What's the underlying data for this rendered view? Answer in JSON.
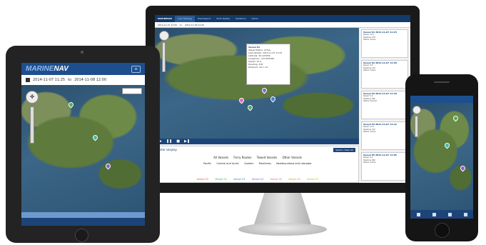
{
  "brand": {
    "logo_marine": "MARINE",
    "logo_nav": "NAV"
  },
  "monitor": {
    "nav_tabs": [
      "MARINENAV",
      "Live Tracking",
      "Fleet Report",
      "Track Replay",
      "Geofence",
      "Admin"
    ],
    "date_from": "2014-11-07 12:00",
    "to_label": "to",
    "date_to": "2014-11-08 12:00",
    "popup": {
      "title": "Vessel 01",
      "rows": [
        "Vessel Status: Active",
        "Last Update: 2014-11-07 11:24",
        "Latitude: 49.123456",
        "Longitude: -123.456789",
        "Speed: 12.4",
        "Heading: 278",
        "Distance: 42.1 nm"
      ]
    },
    "filter_title": "Filter Display",
    "filter_button": "Select / Clear All",
    "filter_row1": [
      "All Vessels",
      "Ferry Routes",
      "Towed Vessels",
      "Other Vessels"
    ],
    "filter_row2": [
      "Pacific",
      "Central and Arctic",
      "Quebec",
      "Maritimes",
      "Newfoundland and Labrador"
    ],
    "vessels": [
      {
        "name": "Vessel 01",
        "color": "#e0534f"
      },
      {
        "name": "Vessel 02",
        "color": "#4caf50"
      },
      {
        "name": "Vessel 03",
        "color": "#3f7fd0"
      },
      {
        "name": "Vessel 04",
        "color": "#8e5bd0"
      },
      {
        "name": "Vessel 05",
        "color": "#e066b0"
      },
      {
        "name": "Vessel 06",
        "color": "#e69a2e"
      },
      {
        "name": "Vessel 07",
        "color": "#c7b52a"
      }
    ],
    "side_cards": [
      {
        "title": "Vessel 01  2014-11-07 11:24",
        "rows": [
          "Speed: 12.4",
          "Heading: 278",
          "Status: Active"
        ]
      },
      {
        "title": "Vessel 02  2014-11-07 11:20",
        "rows": [
          "Speed: 9.8",
          "Heading: 145",
          "Status: Active"
        ]
      },
      {
        "title": "Vessel 03  2014-11-07 11:18",
        "rows": [
          "Speed: 0.0",
          "Heading: 000",
          "Status: Docked"
        ]
      },
      {
        "title": "Vessel 04  2014-11-07 11:12",
        "rows": [
          "Speed: 14.1",
          "Heading: 312",
          "Status: Active"
        ]
      },
      {
        "title": "Vessel 05  2014-11-07 11:05",
        "rows": [
          "Speed: 6.2",
          "Heading: 090",
          "Status: Active"
        ]
      }
    ]
  },
  "tablet": {
    "date_from": "2014-11-07 11:25",
    "to_label": "to",
    "date_to": "2014-11-08 12:00"
  }
}
